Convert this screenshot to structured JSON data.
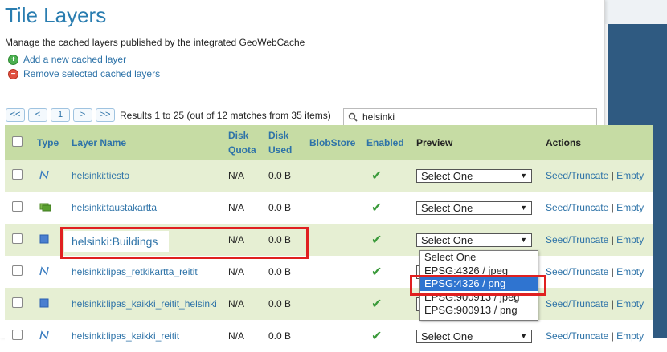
{
  "page": {
    "title": "Tile Layers",
    "description": "Manage the cached layers published by the integrated GeoWebCache",
    "add_link": "Add a new cached layer",
    "remove_link": "Remove selected cached layers"
  },
  "pager": {
    "first": "<<",
    "prev": "<",
    "page": "1",
    "next": ">",
    "last": ">>",
    "results": "Results 1 to 25 (out of 12 matches from 35 items)"
  },
  "search": {
    "value": "helsinki"
  },
  "table": {
    "headers": {
      "type": "Type",
      "layer_name": "Layer Name",
      "disk_quota_1": "Disk",
      "disk_quota_2": "Quota",
      "disk_used_1": "Disk",
      "disk_used_2": "Used",
      "blobstore": "BlobStore",
      "enabled": "Enabled",
      "preview": "Preview",
      "actions": "Actions"
    },
    "rows": [
      {
        "name": "helsinki:tiesto",
        "quota": "N/A",
        "used": "0.0 B",
        "preview": "Select One",
        "icon": "line-layer-icon"
      },
      {
        "name": "helsinki:taustakartta",
        "quota": "N/A",
        "used": "0.0 B",
        "preview": "Select One",
        "icon": "raster-layer-icon"
      },
      {
        "name": "helsinki:Buildings",
        "quota": "N/A",
        "used": "0.0 B",
        "preview": "Select One",
        "icon": "polygon-layer-icon"
      },
      {
        "name": "helsinki:lipas_retkikartta_reitit",
        "quota": "N/A",
        "used": "0.0 B",
        "preview": "Select One",
        "icon": "line-layer-icon"
      },
      {
        "name": "helsinki:lipas_kaikki_reitit_helsinki",
        "quota": "N/A",
        "used": "0.0 B",
        "preview": "Select One",
        "icon": "polygon-layer-icon"
      },
      {
        "name": "helsinki:lipas_kaikki_reitit",
        "quota": "N/A",
        "used": "0.0 B",
        "preview": "Select One",
        "icon": "line-layer-icon"
      }
    ],
    "actions": {
      "seed": "Seed/Truncate",
      "sep": "|",
      "empty": "Empty"
    }
  },
  "dropdown": {
    "options": [
      "Select One",
      "EPSG:4326 / jpeg",
      "EPSG:4326 / png",
      "EPSG:900913 / jpeg",
      "EPSG:900913 / png"
    ],
    "highlighted": "EPSG:4326 / png"
  },
  "colors": {
    "title": "#2a7db0",
    "link": "#2e73a8",
    "header_bg": "#c6dca4",
    "row_alt_bg": "#e6efd3",
    "highlight_box": "#e02020",
    "dropdown_selected": "#2f74d0"
  }
}
